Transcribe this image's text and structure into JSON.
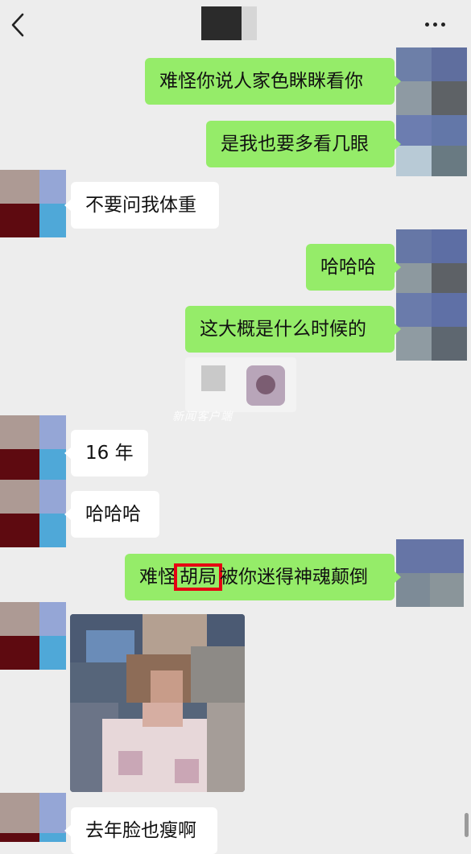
{
  "header": {
    "back_icon": "chevron-left-icon",
    "more_icon": "ellipsis-icon"
  },
  "messages": [
    {
      "side": "me",
      "text": "难怪你说人家色眯眯看你"
    },
    {
      "side": "me",
      "text": "是我也要多看几眼"
    },
    {
      "side": "other",
      "text": "不要问我体重"
    },
    {
      "side": "me",
      "text": "哈哈哈"
    },
    {
      "side": "me",
      "text": "这大概是什么时候的"
    },
    {
      "side": "other",
      "text": "16 年"
    },
    {
      "side": "other",
      "text": "哈哈哈"
    },
    {
      "side": "me",
      "text_before": "难怪",
      "text_highlight": "胡局",
      "text_after": "被你迷得神魂颠倒"
    },
    {
      "side": "other",
      "text": "去年脸也瘦啊"
    }
  ],
  "watermark": "新闻客户端",
  "colors": {
    "me_bubble": "#95ec69",
    "other_bubble": "#ffffff",
    "highlight_border": "#e60012",
    "background": "#ededed"
  }
}
